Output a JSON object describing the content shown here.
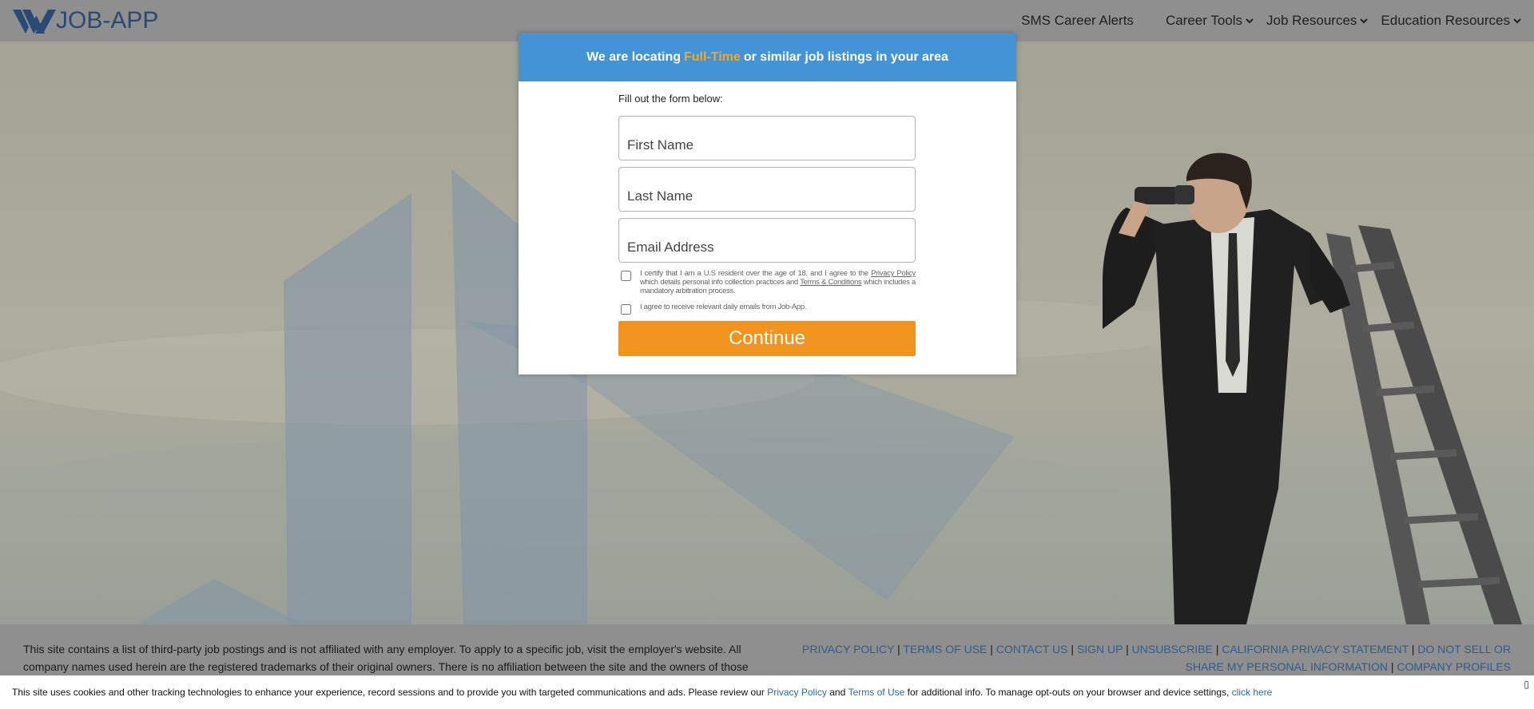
{
  "header": {
    "logo_text": "JOB-APP",
    "nav": [
      {
        "label": "SMS Career Alerts",
        "dropdown": false
      },
      {
        "label": "Career Tools",
        "dropdown": true
      },
      {
        "label": "Job Resources",
        "dropdown": true
      },
      {
        "label": "Education Resources",
        "dropdown": true
      }
    ]
  },
  "modal": {
    "headline_prefix": "We are locating",
    "headline_highlight": "Full-Time",
    "headline_suffix": "or similar job listings in your area",
    "form_intro": "Fill out the form below:",
    "fields": {
      "first_name_placeholder": "First Name",
      "last_name_placeholder": "Last Name",
      "email_placeholder": "Email Address"
    },
    "consent1_prefix": "I certify that I am a U.S resident over the age of 18, and I agree to the",
    "consent1_link1": "Privacy Policy",
    "consent1_mid": "which details personal info collection practices and",
    "consent1_link2": "Terms & Conditions",
    "consent1_suffix": "which includes a mandatory arbitration process.",
    "consent2": "I agree to receive relevant daily emails from Job-App.",
    "continue_label": "Continue"
  },
  "footer": {
    "disclaimer": "This site contains a list of third-party job postings and is not affiliated with any employer. To apply to a specific job, visit the employer's website. All company names used herein are the registered trademarks of their original owners. There is no affiliation between the site and the owners of those",
    "links": [
      "PRIVACY POLICY",
      "TERMS OF USE",
      "CONTACT US",
      "SIGN UP",
      "UNSUBSCRIBE",
      "CALIFORNIA PRIVACY STATEMENT",
      "DO NOT SELL OR SHARE MY PERSONAL INFORMATION",
      "COMPANY PROFILES"
    ]
  },
  "cookie": {
    "text1": "This site uses cookies and other tracking technologies to enhance your experience, record sessions and to provide you with targeted communications and ads. Please review our",
    "privacy_link": "Privacy Policy",
    "and": "and",
    "terms_link": "Terms of Use",
    "text2": "for additional info. To manage opt-outs on your browser and device settings,",
    "click_here": "click here",
    "close_glyph": "▯"
  },
  "colors": {
    "header_bg": "#8f8f8f",
    "modal_header": "#4493d4",
    "highlight": "#f7a525",
    "cta": "#f0941f",
    "link": "#2e5c8f"
  }
}
